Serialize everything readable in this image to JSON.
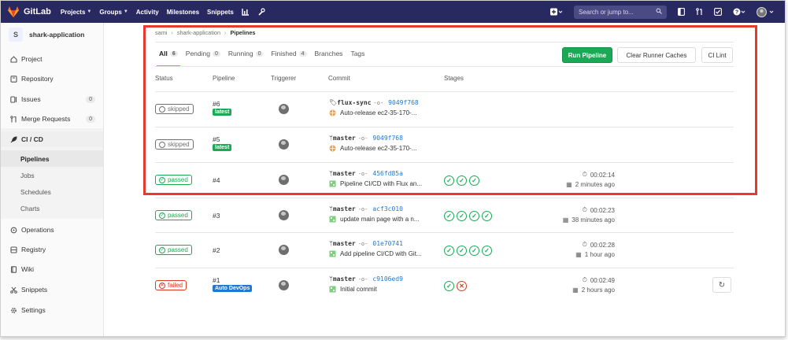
{
  "topnav": {
    "brand": "GitLab",
    "links": [
      {
        "label": "Projects",
        "caret": true
      },
      {
        "label": "Groups",
        "caret": true
      },
      {
        "label": "Activity",
        "caret": false
      },
      {
        "label": "Milestones",
        "caret": false
      },
      {
        "label": "Snippets",
        "caret": false
      }
    ],
    "search_placeholder": "Search or jump to..."
  },
  "sidebar": {
    "avatar_letter": "S",
    "project_name": "shark-application",
    "items": [
      {
        "label": "Project",
        "icon": "home-icon"
      },
      {
        "label": "Repository",
        "icon": "book-icon"
      },
      {
        "label": "Issues",
        "icon": "issues-icon",
        "count": "0"
      },
      {
        "label": "Merge Requests",
        "icon": "merge-icon",
        "count": "0"
      },
      {
        "label": "CI / CD",
        "icon": "rocket-icon"
      },
      {
        "label": "Operations",
        "icon": "cloud-icon"
      },
      {
        "label": "Registry",
        "icon": "registry-icon"
      },
      {
        "label": "Wiki",
        "icon": "wiki-icon"
      },
      {
        "label": "Snippets",
        "icon": "scissors-icon"
      },
      {
        "label": "Settings",
        "icon": "gear-icon"
      }
    ],
    "ci_sub": [
      "Pipelines",
      "Jobs",
      "Schedules",
      "Charts"
    ]
  },
  "breadcrumb": [
    "sami",
    "shark-application",
    "Pipelines"
  ],
  "tabs": [
    {
      "label": "All",
      "count": "6"
    },
    {
      "label": "Pending",
      "count": "0"
    },
    {
      "label": "Running",
      "count": "0"
    },
    {
      "label": "Finished",
      "count": "4"
    },
    {
      "label": "Branches"
    },
    {
      "label": "Tags"
    }
  ],
  "buttons": {
    "run": "Run Pipeline",
    "clear": "Clear Runner Caches",
    "lint": "CI Lint"
  },
  "columns": {
    "status": "Status",
    "pipeline": "Pipeline",
    "triggerer": "Triggerer",
    "commit": "Commit",
    "stages": "Stages"
  },
  "pipelines": [
    {
      "status": "skipped",
      "id": "#6",
      "tag": "latest",
      "ref": "flux-sync",
      "ref_type": "tag",
      "sha": "9049f768",
      "message": "Auto-release ec2-35-170-...",
      "stages": [],
      "duration": "",
      "finished": ""
    },
    {
      "status": "skipped",
      "id": "#5",
      "tag": "latest",
      "ref": "master",
      "ref_type": "branch",
      "sha": "9049f768",
      "message": "Auto-release ec2-35-170-...",
      "stages": [],
      "duration": "",
      "finished": ""
    },
    {
      "status": "passed",
      "id": "#4",
      "tag": "",
      "ref": "master",
      "ref_type": "branch",
      "sha": "456fd85a",
      "message": "Pipeline CI/CD with Flux an...",
      "stages": [
        "ok",
        "ok",
        "ok"
      ],
      "duration": "00:02:14",
      "finished": "2 minutes ago"
    },
    {
      "status": "passed",
      "id": "#3",
      "tag": "",
      "ref": "master",
      "ref_type": "branch",
      "sha": "acf3c010",
      "message": "update main page with a n...",
      "stages": [
        "ok",
        "ok",
        "ok",
        "ok"
      ],
      "duration": "00:02:23",
      "finished": "38 minutes ago"
    },
    {
      "status": "passed",
      "id": "#2",
      "tag": "",
      "ref": "master",
      "ref_type": "branch",
      "sha": "01e70741",
      "message": "Add pipeline CI/CD with Git...",
      "stages": [
        "ok",
        "ok",
        "ok",
        "ok"
      ],
      "duration": "00:02:28",
      "finished": "1 hour ago"
    },
    {
      "status": "failed",
      "id": "#1",
      "tag": "Auto DevOps",
      "ref": "master",
      "ref_type": "branch",
      "sha": "c9106ed9",
      "message": "Initial commit",
      "stages": [
        "ok",
        "fail"
      ],
      "duration": "00:02:49",
      "finished": "2 hours ago"
    }
  ],
  "colors": {
    "nav_bg": "#292961",
    "run_button": "#1aaa55",
    "passed": "#1aaa55",
    "failed": "#db3b21",
    "highlight": "#e53a2d"
  }
}
